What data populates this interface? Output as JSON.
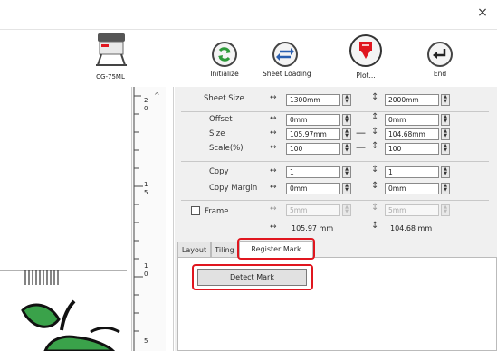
{
  "window": {
    "close_label": "×"
  },
  "device": {
    "name": "CG-75ML"
  },
  "toolbar": {
    "initialize": "Initialize",
    "sheet_loading": "Sheet Loading",
    "plot": "Plot...",
    "end": "End"
  },
  "form": {
    "sheet_size": {
      "label": "Sheet Size",
      "x": "1300mm",
      "y": "2000mm"
    },
    "offset": {
      "label": "Offset",
      "x": "0mm",
      "y": "0mm"
    },
    "size": {
      "label": "Size",
      "x": "105.97mm",
      "y": "104.68mm"
    },
    "scale": {
      "label": "Scale(%)",
      "x": "100",
      "y": "100"
    },
    "copy": {
      "label": "Copy",
      "x": "1",
      "y": "1"
    },
    "copy_margin": {
      "label": "Copy Margin",
      "x": "0mm",
      "y": "0mm"
    },
    "frame": {
      "label": "Frame",
      "checked": false,
      "x": "5mm",
      "y": "5mm"
    },
    "result": {
      "x": "105.97 mm",
      "y": "104.68 mm"
    }
  },
  "tabs": {
    "layout": "Layout",
    "tiling": "Tiling",
    "register_mark": "Register Mark",
    "active": "Register Mark"
  },
  "register_mark": {
    "detect_button": "Detect Mark"
  },
  "ruler": {
    "marks": [
      "2",
      "0",
      "1",
      "5",
      "1",
      "0",
      "5"
    ]
  },
  "colors": {
    "highlight": "#e0161f",
    "accent_green": "#2e9a3a",
    "accent_blue": "#2a5fb0",
    "plot_red": "#e0161f"
  }
}
